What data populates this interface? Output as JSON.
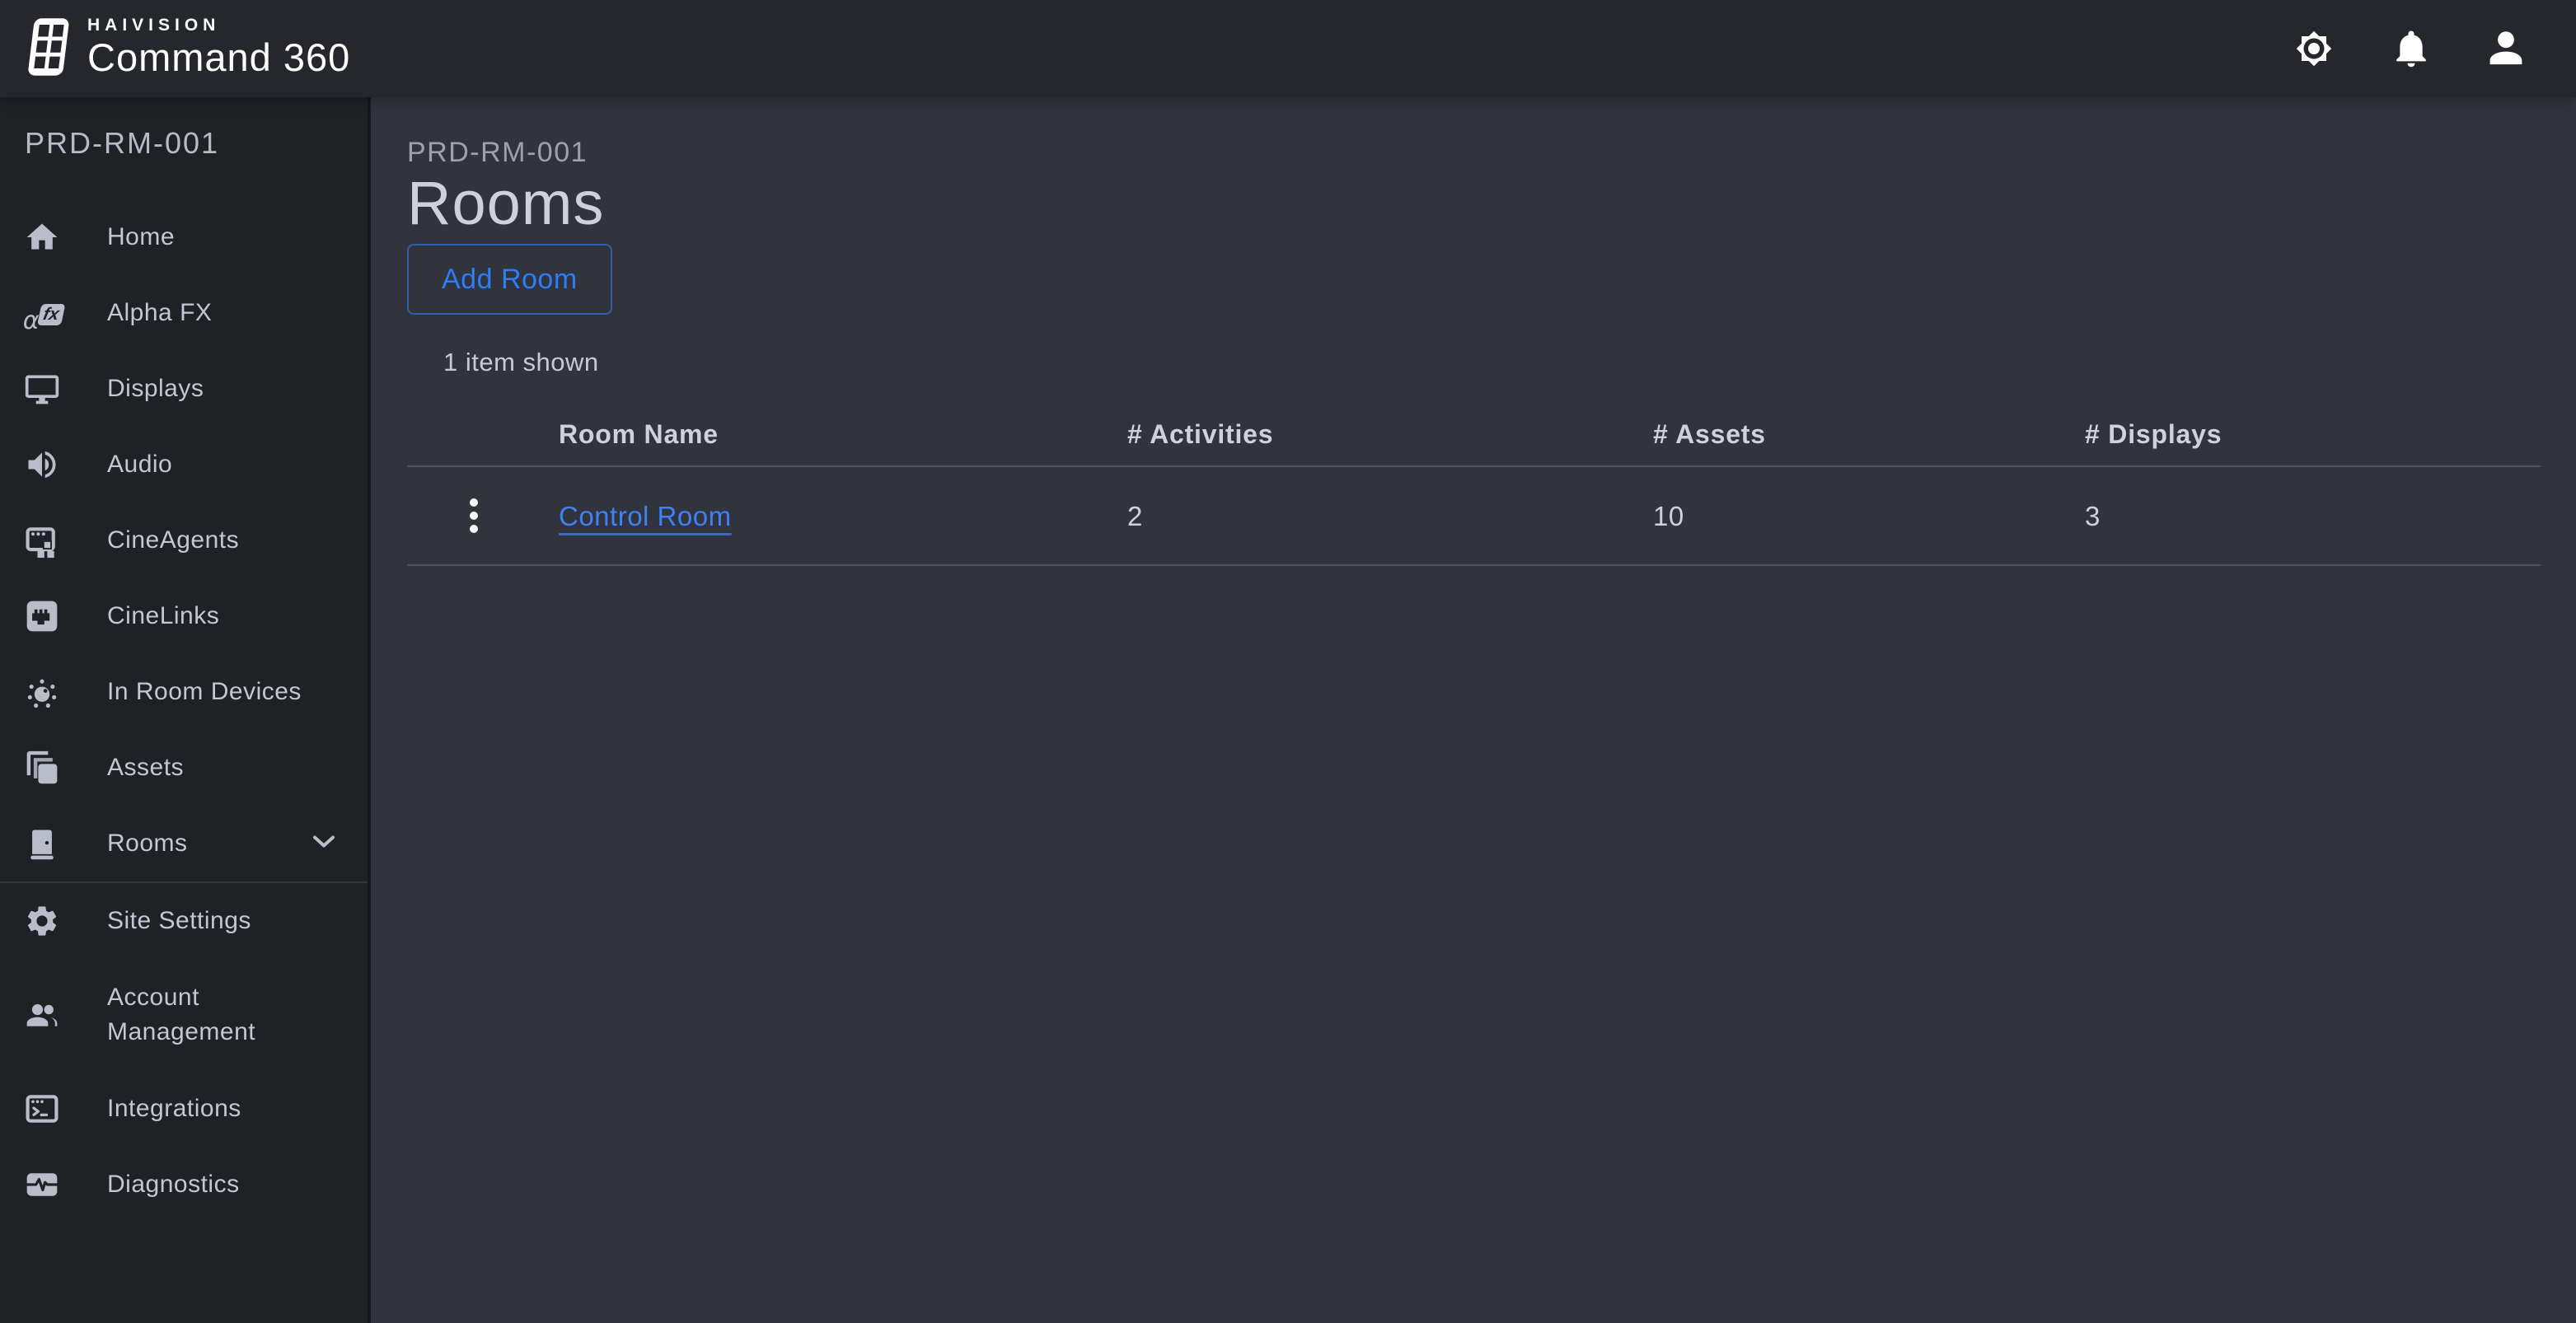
{
  "topbar": {
    "brand_name": "HAIVISION",
    "product_name": "Command 360",
    "icons": [
      "settings-gear",
      "notifications-bell",
      "user-profile"
    ]
  },
  "sidebar": {
    "header": "PRD-RM-001",
    "alpha_icon": {
      "alpha": "α",
      "fx": "fx"
    },
    "items": [
      {
        "label": "Home",
        "icon": "home-icon"
      },
      {
        "label": "Alpha FX",
        "icon": "alpha-fx-icon"
      },
      {
        "label": "Displays",
        "icon": "display-icon"
      },
      {
        "label": "Audio",
        "icon": "speaker-icon"
      },
      {
        "label": "CineAgents",
        "icon": "window-agents-icon"
      },
      {
        "label": "CineLinks",
        "icon": "ethernet-icon"
      },
      {
        "label": "In Room Devices",
        "icon": "device-hub-icon"
      },
      {
        "label": "Assets",
        "icon": "layers-icon"
      },
      {
        "label": "Rooms",
        "icon": "door-icon",
        "expanded": false
      },
      {
        "label": "Site Settings",
        "icon": "gear-icon"
      },
      {
        "label": "Account Management",
        "icon": "people-icon"
      },
      {
        "label": "Integrations",
        "icon": "terminal-icon"
      },
      {
        "label": "Diagnostics",
        "icon": "diagnostics-icon"
      }
    ]
  },
  "main": {
    "breadcrumb": "PRD-RM-001",
    "title": "Rooms",
    "add_button_label": "Add Room",
    "items_shown": "1 item shown",
    "table": {
      "columns": [
        "Room Name",
        "# Activities",
        "# Assets",
        "# Displays"
      ],
      "rows": [
        {
          "name": "Control Room",
          "activities": "2",
          "assets": "10",
          "displays": "3"
        }
      ]
    }
  },
  "colors": {
    "topbar_bg": "#26272c",
    "sidebar_bg": "#1f2125",
    "main_bg": "#32343d",
    "accent_blue": "#2e7cf6",
    "link_blue": "#3f80f2",
    "text_light": "#ced2db",
    "text_muted": "#9da1ac"
  }
}
